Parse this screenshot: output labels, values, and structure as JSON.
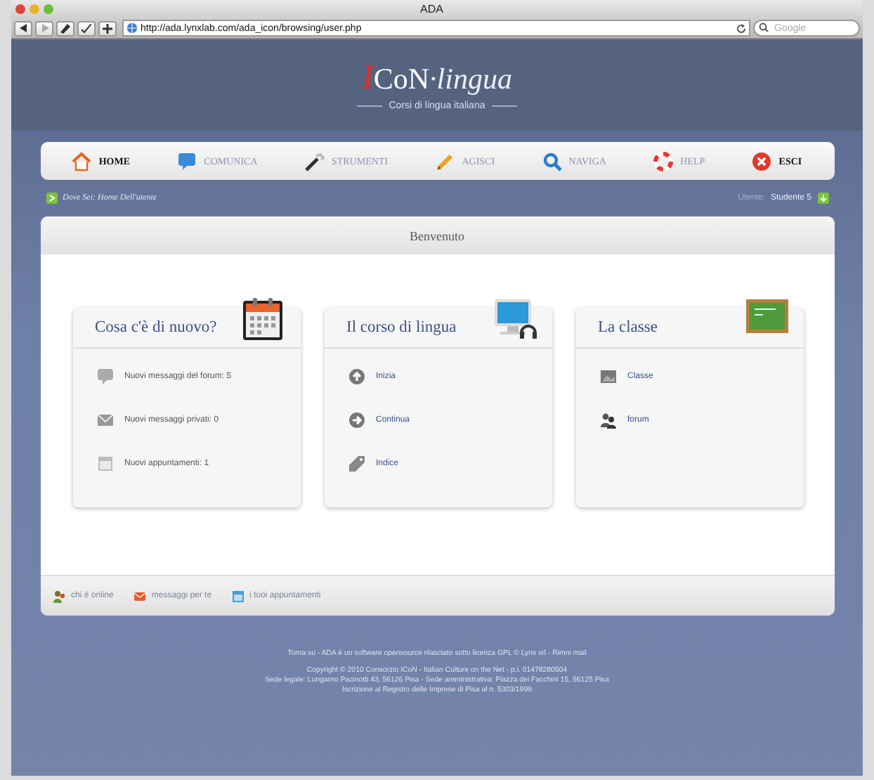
{
  "window": {
    "title": "ADA",
    "url": "http://ada.lynxlab.com/ada_icon/browsing/user.php",
    "search_placeholder": "Google"
  },
  "header": {
    "logo_initial": "I",
    "logo_rest": "CoN",
    "logo_suffix": "·lingua",
    "tagline": "Corsi di lingua italiana"
  },
  "nav": [
    {
      "label": "HOME",
      "kind": "home",
      "highlighted": true
    },
    {
      "label": "COMUNICA",
      "kind": "bubble",
      "highlighted": false
    },
    {
      "label": "STRUMENTI",
      "kind": "tools",
      "highlighted": false
    },
    {
      "label": "AGISCI",
      "kind": "pencil",
      "highlighted": false
    },
    {
      "label": "NAVIGA",
      "kind": "search",
      "highlighted": false
    },
    {
      "label": "HELP",
      "kind": "lifebuoy",
      "highlighted": false
    },
    {
      "label": "ESCI",
      "kind": "close",
      "highlighted": true
    }
  ],
  "breadcrumb": {
    "text": "Dove Sei: Home Dell'utente",
    "user_label": "Utente:",
    "user_name": "Studente 5"
  },
  "panel": {
    "title": "Benvenuto"
  },
  "cards": [
    {
      "title": "Cosa c'è di nuovo?",
      "kind": "calendar",
      "items": [
        {
          "kind": "bubble",
          "label": "Nuovi messaggi del forum: 5",
          "link": false
        },
        {
          "kind": "mail",
          "label": "Nuovi messaggi privati: 0",
          "link": false
        },
        {
          "kind": "calendar",
          "label": "Nuovi appuntamenti: 1",
          "link": false
        }
      ]
    },
    {
      "title": "Il corso di lingua",
      "kind": "monitor",
      "items": [
        {
          "kind": "up",
          "label": "Inizia",
          "link": true
        },
        {
          "kind": "right",
          "label": "Continua",
          "link": true
        },
        {
          "kind": "tag",
          "label": "Indice",
          "link": true
        }
      ]
    },
    {
      "title": "La classe",
      "kind": "board",
      "items": [
        {
          "kind": "image",
          "label": "Classe",
          "link": true
        },
        {
          "kind": "people",
          "label": "forum",
          "link": true
        }
      ]
    }
  ],
  "footer_links": [
    {
      "kind": "people",
      "label": "chi è online"
    },
    {
      "kind": "mail",
      "label": "messaggi per te"
    },
    {
      "kind": "calendar",
      "label": "i tuoi appuntamenti"
    }
  ],
  "footer_lines": [
    "Torna su - ADA è un software opensource rilasciato sotto licenza GPL © Lynx srl - Rimni mail",
    "Copyright © 2010 Consorzio ICoN - Italian Culture on the Net - p.i. 01478280504",
    "Sede legale: Lungarno Pacinotti 43, 56126 Pisa - Sede amministrativa: Piazza dei Facchini 15, 56125 Pisa",
    "Iscrizione al Registro delle Imprese di Pisa al n. 5303/1999"
  ]
}
